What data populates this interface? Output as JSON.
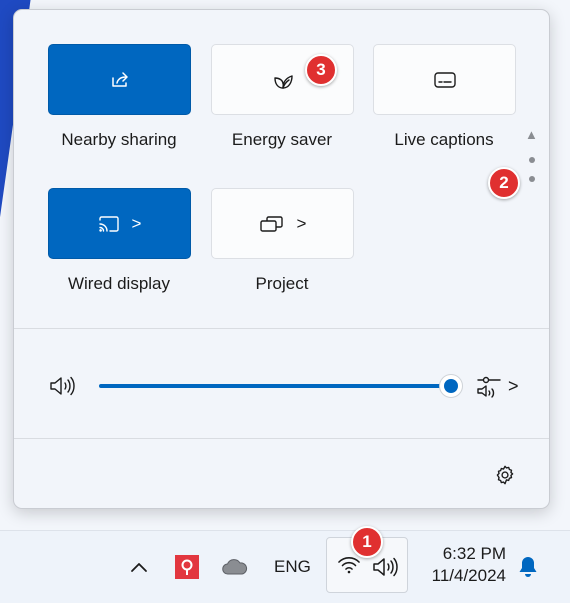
{
  "quick_settings": {
    "tiles": [
      {
        "label": "Nearby sharing",
        "icon": "share-icon",
        "state": "on"
      },
      {
        "label": "Energy saver",
        "icon": "leaf-icon",
        "state": "off"
      },
      {
        "label": "Live captions",
        "icon": "captions-icon",
        "state": "off"
      },
      {
        "label": "Wired display",
        "icon": "cast-icon",
        "state": "on",
        "has_chevron": true
      },
      {
        "label": "Project",
        "icon": "project-icon",
        "state": "off",
        "has_chevron": true
      }
    ],
    "chevron": ">",
    "page_up": "▲",
    "volume": {
      "level": 1.0,
      "icon": "speaker-icon",
      "mixer_icon": "volume-mixer-icon",
      "chevron": ">"
    },
    "settings_icon": "gear-icon"
  },
  "badges": {
    "one": "1",
    "two": "2",
    "three": "3"
  },
  "taskbar": {
    "overflow_chevron": "^",
    "language": "ENG",
    "time": "6:32 PM",
    "date": "11/4/2024"
  },
  "colors": {
    "accent": "#0067c0",
    "badge": "#e03030"
  }
}
